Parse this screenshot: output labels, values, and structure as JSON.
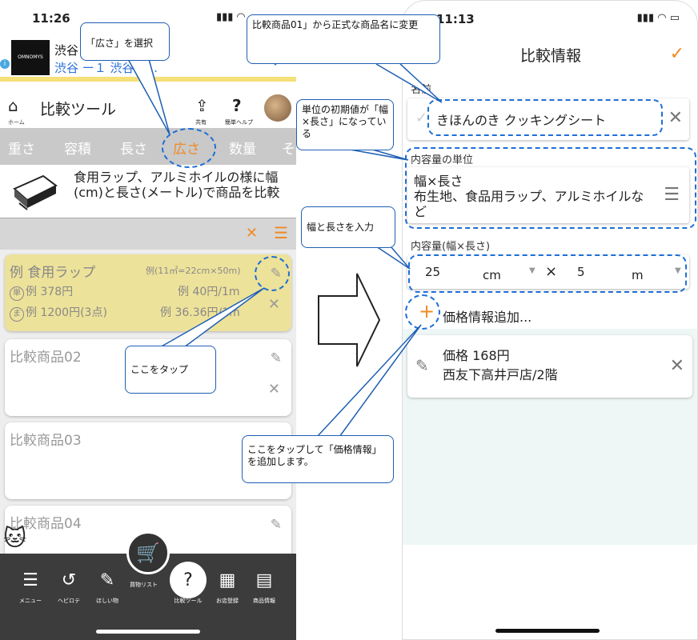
{
  "left": {
    "time": "11:26",
    "ad": {
      "line1": "渋谷 分〜21時00分",
      "line2": "渋谷 ー１ 渋谷ロ...",
      "logo": "OMNOMYS"
    },
    "header": {
      "home_label": "ホーム",
      "title": "比較ツール",
      "share_label": "共有",
      "help_label": "簡単ヘルプ"
    },
    "tabs": [
      "重さ",
      "容積",
      "長さ",
      "広さ",
      "数量",
      "そ"
    ],
    "description": "食用ラップ、アルミホイルの様に幅(cm)と長さ(メートル)で商品を比較",
    "cards": [
      {
        "name": "例 食用ラップ",
        "hint": "例(11㎡=22cm×50m)",
        "single_badge": "単",
        "single_price": "例 378円",
        "single_unit": "例 40円/1m",
        "multi_badge": "ま",
        "multi_price": "例 1200円(3点)",
        "multi_unit": "例 36.36円/1m"
      },
      {
        "name": "比較商品02"
      },
      {
        "name": "比較商品03"
      },
      {
        "name": "比較商品04"
      }
    ],
    "bottom_nav": [
      {
        "label": "メニュー",
        "icon": "☰"
      },
      {
        "label": "ヘビロテ",
        "icon": "↺"
      },
      {
        "label": "ほしい物",
        "icon": "✎"
      },
      {
        "label": "買物リスト",
        "icon": "🛒"
      },
      {
        "label": "比較ツール",
        "icon": "?"
      },
      {
        "label": "お店登録",
        "icon": "▦"
      },
      {
        "label": "商品情報",
        "icon": "▤"
      }
    ]
  },
  "right": {
    "time": "11:13",
    "title": "比較情報",
    "name_label": "名前",
    "name_value": "きほんのき クッキングシート",
    "unit_label": "内容量の単位",
    "unit_value": "幅×長さ\n布生地、食品用ラップ、アルミホイルなど",
    "capacity_label": "内容量(幅×長さ)",
    "width_value": "25",
    "width_unit": "cm",
    "length_value": "5",
    "length_unit": "m",
    "add_price_label": "価格情報追加...",
    "price_card": {
      "line1": "価格 168円",
      "line2": "西友下高井戸店/2階"
    }
  },
  "callouts": {
    "select_area": "「広さ」を選択",
    "rename": "比較商品01」から正式な商品名に変更",
    "default_unit": "単位の初期値が「幅×長さ」になっている",
    "enter_size": "幅と長さを入力",
    "tap_here": "ここをタップ",
    "add_price": "ここをタップして「価格情報」を追加します。"
  },
  "colors": {
    "accent": "#f08a24",
    "callout_border": "#1e5fb3",
    "card_highlight": "#ede29a"
  }
}
